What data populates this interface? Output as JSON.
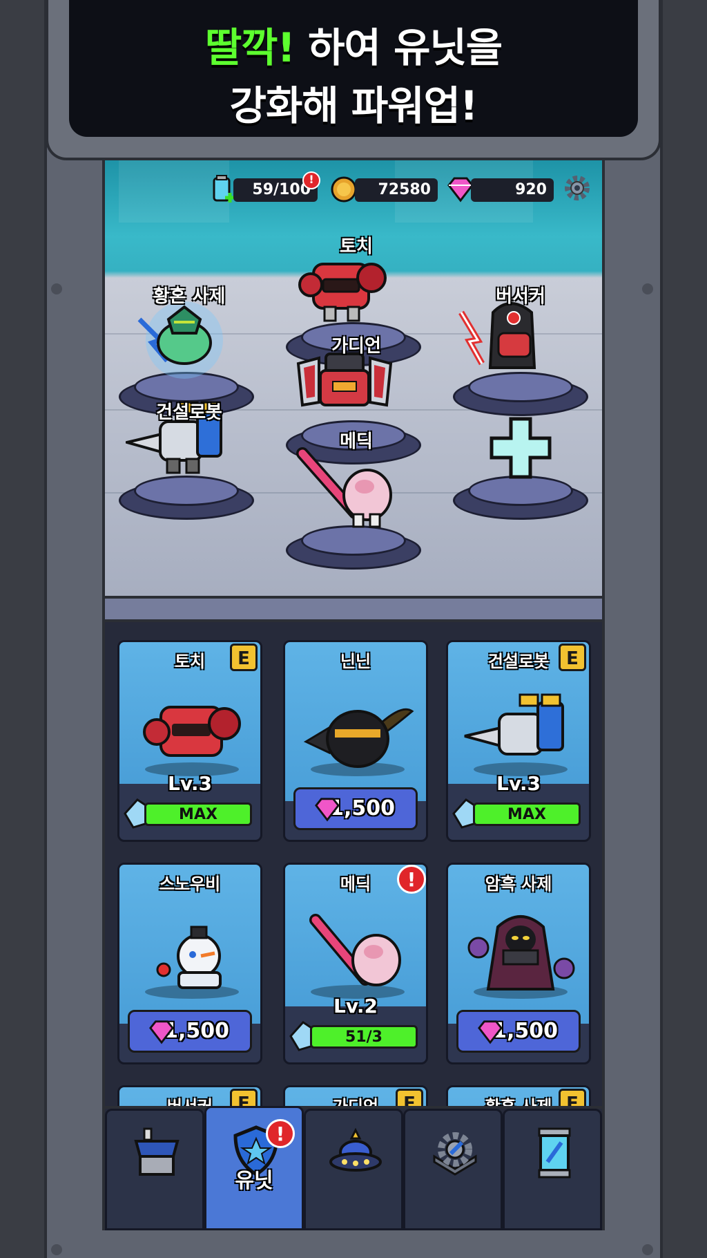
{
  "banner": {
    "highlight": "딸깍!",
    "line1_rest": " 하여 유닛을",
    "line2": "강화해 파워업!"
  },
  "hud": {
    "energy": "59/100",
    "energy_alert": "!",
    "gold": "72580",
    "gems": "920"
  },
  "pedestals": [
    {
      "label": "토치"
    },
    {
      "label": "황혼 사제"
    },
    {
      "label": "버서커"
    },
    {
      "label": "가디언"
    },
    {
      "label": "건설로봇"
    },
    {
      "label": "메딕"
    }
  ],
  "cards": [
    {
      "name": "토치",
      "grade": "E",
      "level": "Lv.3",
      "bar": "MAX"
    },
    {
      "name": "닌닌",
      "price": "1,500"
    },
    {
      "name": "건설로봇",
      "grade": "E",
      "level": "Lv.3",
      "bar": "MAX"
    },
    {
      "name": "스노우비",
      "price": "1,500"
    },
    {
      "name": "메딕",
      "alert": "!",
      "level": "Lv.2",
      "bar": "51/3"
    },
    {
      "name": "암흑 사제",
      "price": "1,500"
    },
    {
      "name": "버서커",
      "grade": "E"
    },
    {
      "name": "가디언",
      "grade": "E"
    },
    {
      "name": "황혼 사제",
      "grade": "E"
    }
  ],
  "nav": {
    "active_label": "유닛",
    "alert": "!",
    "tabs": [
      "shop-icon",
      "unit-shield-icon",
      "ufo-icon",
      "gear-wrench-icon",
      "capsule-icon"
    ]
  },
  "colors": {
    "highlight_green": "#5dff2f",
    "bar_green": "#4ef02a",
    "buy_blue": "#4e66d8",
    "active_tab": "#4b78d6"
  }
}
